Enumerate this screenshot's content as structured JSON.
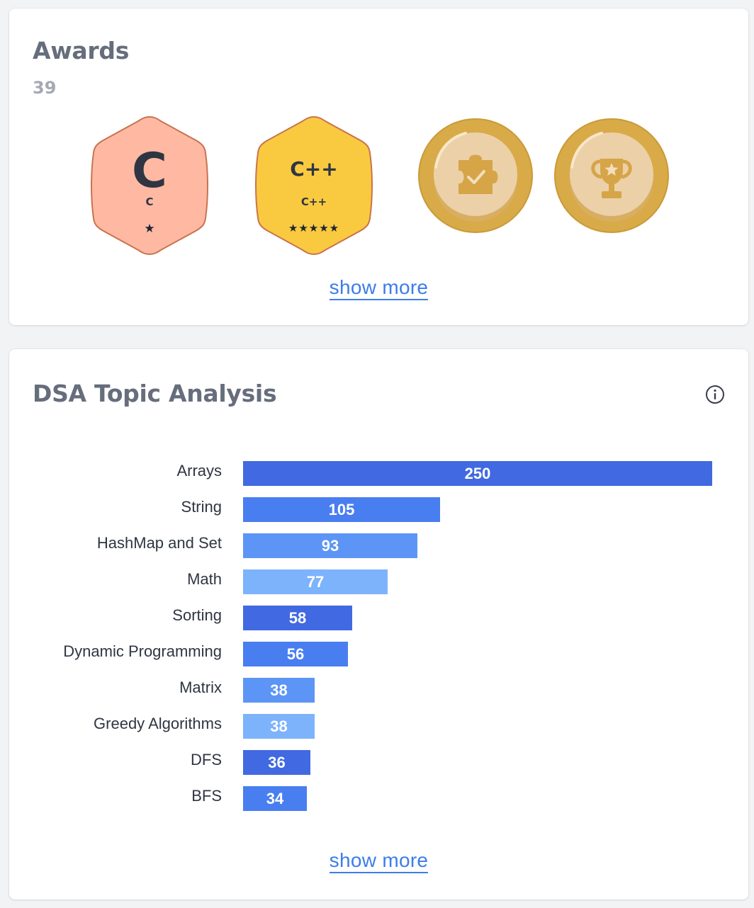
{
  "awards": {
    "title": "Awards",
    "count": "39",
    "show_more": "show more",
    "badges": [
      {
        "name": "C",
        "glyph": "C",
        "label": "C",
        "stars": "★",
        "color": "#ffb9a3"
      },
      {
        "name": "C++",
        "glyph": "C++",
        "label": "C++",
        "stars": "★★★★★",
        "color": "#f9ca3f"
      },
      {
        "name": "puzzle-medal",
        "icon": "puzzle-check-icon",
        "color": "#d9aa48"
      },
      {
        "name": "trophy-medal",
        "icon": "trophy-star-icon",
        "color": "#d9aa48"
      }
    ]
  },
  "dsa": {
    "title": "DSA Topic Analysis",
    "show_more": "show more",
    "info_icon": "info-icon"
  },
  "chart_data": {
    "type": "bar",
    "orientation": "horizontal",
    "categories": [
      "Arrays",
      "String",
      "HashMap and Set",
      "Math",
      "Sorting",
      "Dynamic Programming",
      "Matrix",
      "Greedy Algorithms",
      "DFS",
      "BFS"
    ],
    "values": [
      250,
      105,
      93,
      77,
      58,
      56,
      38,
      38,
      36,
      34
    ],
    "colors": [
      "#4169e1",
      "#497ef0",
      "#5c95f6",
      "#7db3fb",
      "#4169e1",
      "#497ef0",
      "#5c95f6",
      "#7db3fb",
      "#4169e1",
      "#497ef0"
    ],
    "xlim": [
      0,
      250
    ],
    "data_labels": true,
    "grid": false,
    "legend": "none"
  }
}
